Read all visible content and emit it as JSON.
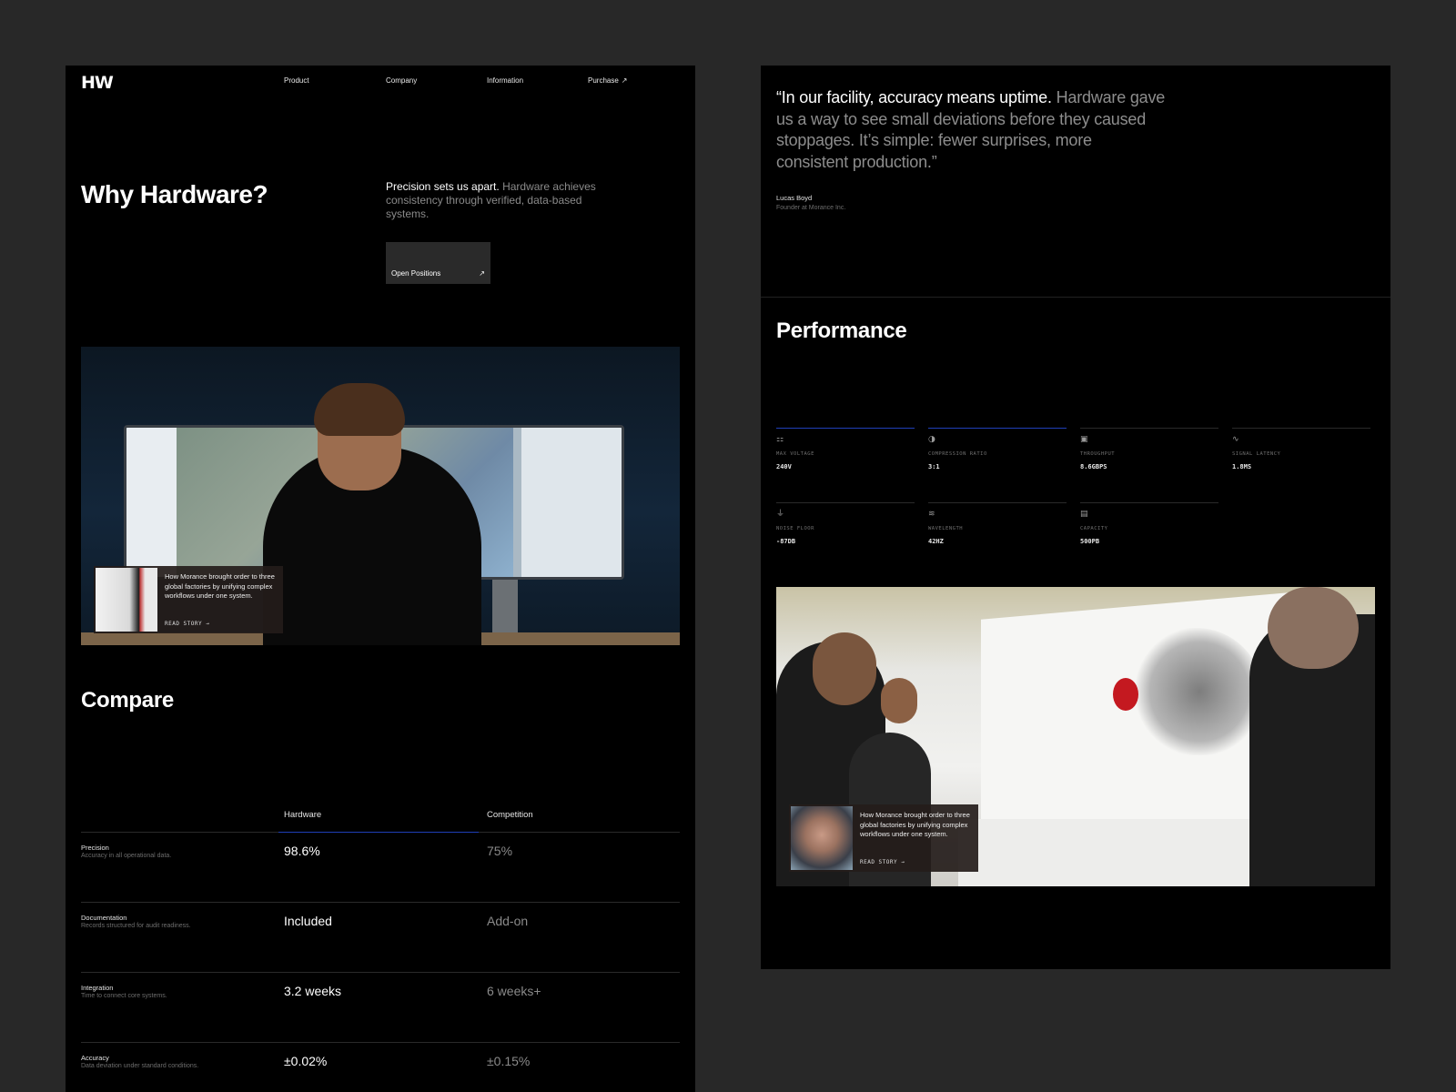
{
  "nav": {
    "logo": "HW",
    "items": [
      "Product",
      "Company",
      "Information",
      "Purchase"
    ],
    "purchase_icon": "arrow-up-right-icon"
  },
  "hero": {
    "title": "Why Hardware?",
    "text_highlight": "Precision sets us apart.",
    "text_rest": " Hardware achieves consistency through verified, data-based systems.",
    "button_label": "Open Positions"
  },
  "story1": {
    "text": "How Morance brought order to three global factories by unifying complex workflows under one system.",
    "link": "READ STORY →"
  },
  "compare": {
    "title": "Compare",
    "headers": [
      "Hardware",
      "Competition"
    ],
    "rows": [
      {
        "label": "Precision",
        "sub": "Accuracy in all operational data.",
        "hardware": "98.6%",
        "competition": "75%"
      },
      {
        "label": "Documentation",
        "sub": "Records structured for audit readiness.",
        "hardware": "Included",
        "competition": "Add-on"
      },
      {
        "label": "Integration",
        "sub": "Time to connect core systems.",
        "hardware": "3.2 weeks",
        "competition": "6 weeks+"
      },
      {
        "label": "Accuracy",
        "sub": "Data deviation under standard conditions.",
        "hardware": "±0.02%",
        "competition": "±0.15%"
      }
    ]
  },
  "testimonial": {
    "quote_highlight": "“In our facility, accuracy means uptime.",
    "quote_rest": " Hardware gave us a way to see small deviations before they caused stoppages. It’s simple: fewer surprises, more consistent production.”",
    "author": "Lucas Boyd",
    "role": "Founder at Morance Inc."
  },
  "performance": {
    "title": "Performance",
    "metrics": [
      {
        "icon": "voltage-icon",
        "label": "MAX VOLTAGE",
        "value": "240V"
      },
      {
        "icon": "compression-icon",
        "label": "COMPRESSION RATIO",
        "value": "3:1"
      },
      {
        "icon": "chip-icon",
        "label": "THROUGHPUT",
        "value": "8.6GBPS"
      },
      {
        "icon": "signal-icon",
        "label": "SIGNAL LATENCY",
        "value": "1.8MS"
      },
      {
        "icon": "ground-icon",
        "label": "NOISE FLOOR",
        "value": "-87DB"
      },
      {
        "icon": "wave-icon",
        "label": "WAVELENGTH",
        "value": "42HZ"
      },
      {
        "icon": "storage-icon",
        "label": "CAPACITY",
        "value": "500PB"
      }
    ]
  },
  "story2": {
    "text": "How Morance brought order to three global factories by unifying complex workflows under one system.",
    "link": "READ STORY →"
  },
  "colors": {
    "background": "#282828",
    "panel": "#000000",
    "accent_blue": "#1f3fb8",
    "muted_text": "#8a8a8a"
  }
}
